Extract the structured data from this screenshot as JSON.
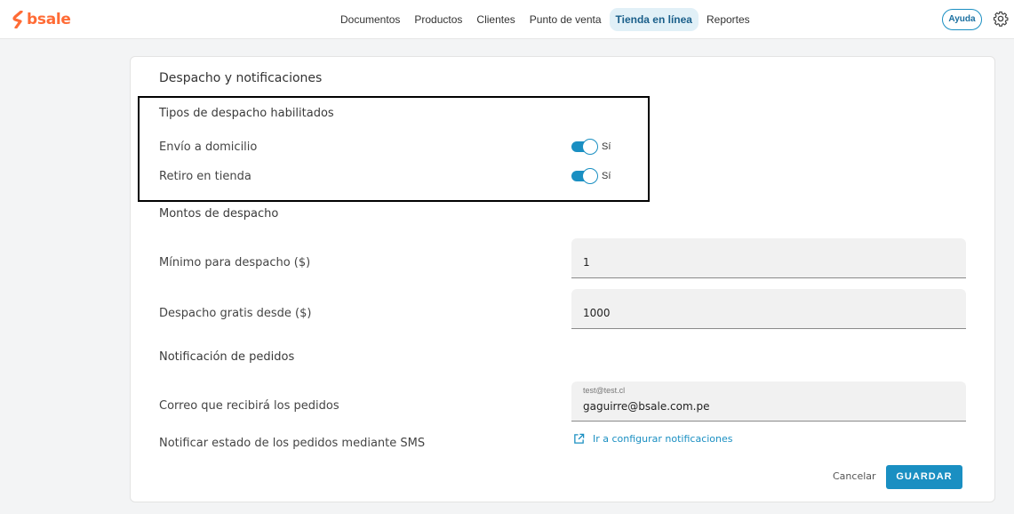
{
  "brand": {
    "logo_text": "bsale",
    "accent": "#ff6b35",
    "primary": "#1a8fc2"
  },
  "nav": {
    "items": [
      {
        "label": "Documentos"
      },
      {
        "label": "Productos"
      },
      {
        "label": "Clientes"
      },
      {
        "label": "Punto de venta"
      },
      {
        "label": "Tienda en línea",
        "active": true
      },
      {
        "label": "Reportes"
      }
    ],
    "help_label": "Ayuda",
    "settings_icon": "gear-icon"
  },
  "card": {
    "title": "Despacho y notificaciones",
    "shipping_types": {
      "heading": "Tipos de despacho habilitados",
      "home_delivery": {
        "label": "Envío a domicilio",
        "enabled": true,
        "state_label": "Sí"
      },
      "store_pickup": {
        "label": "Retiro en tienda",
        "enabled": true,
        "state_label": "Sí"
      }
    },
    "amounts": {
      "heading": "Montos de despacho",
      "minimum": {
        "label": "Mínimo para despacho ($)",
        "value": "1"
      },
      "free_from": {
        "label": "Despacho gratis desde ($)",
        "value": "1000"
      }
    },
    "notifications": {
      "heading": "Notificación de pedidos",
      "email": {
        "label": "Correo que recibirá los pedidos",
        "placeholder": "test@test.cl",
        "value": "gaguirre@bsale.com.pe"
      },
      "sms": {
        "label": "Notificar estado de los pedidos mediante SMS",
        "link_text": "Ir a configurar notificaciones",
        "link_icon": "external-link-icon"
      }
    },
    "actions": {
      "cancel_label": "Cancelar",
      "save_label": "GUARDAR"
    }
  }
}
